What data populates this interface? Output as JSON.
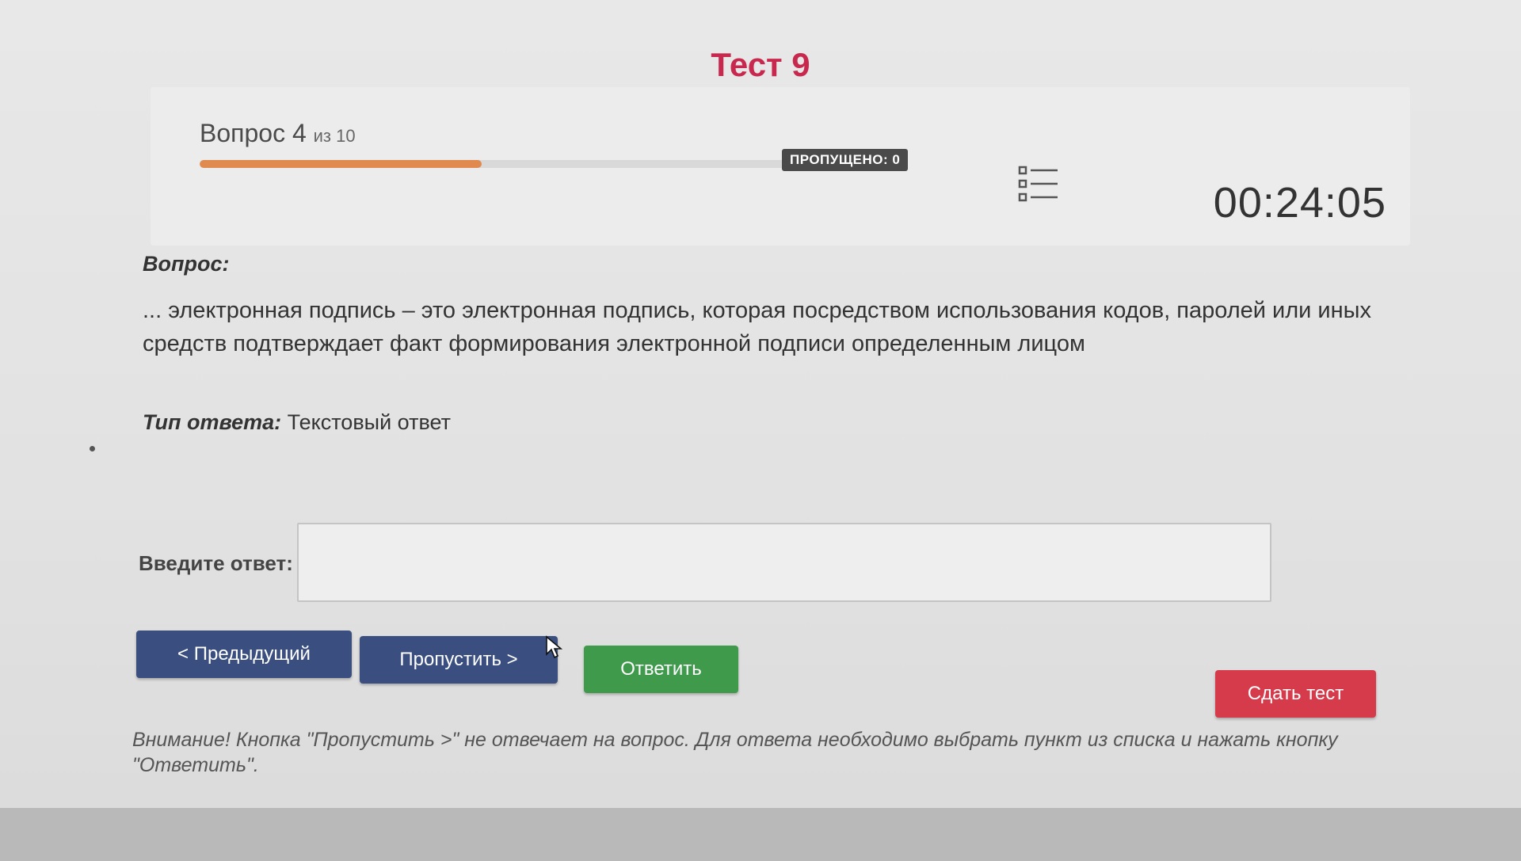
{
  "test": {
    "title": "Тест 9"
  },
  "header": {
    "question_word": "Вопрос 4",
    "question_of": "из 10",
    "progress_fraction": 0.4,
    "skipped_label": "ПРОПУЩЕНО: 0",
    "list_icon": "question-list-icon",
    "timer": "00:24:05"
  },
  "question": {
    "label": "Вопрос:",
    "text": "... электронная подпись – это электронная подпись, которая посредством использования кодов, паролей или иных средств подтверждает факт формирования электронной подписи определенным лицом"
  },
  "answer_type": {
    "label": "Тип ответа:",
    "value": "Текстовый ответ"
  },
  "answer": {
    "label": "Введите ответ:",
    "value": "",
    "placeholder": ""
  },
  "buttons": {
    "prev": "< Предыдущий",
    "skip": "Пропустить >",
    "answer": "Ответить",
    "submit": "Сдать тест"
  },
  "note": "Внимание! Кнопка \"Пропустить >\" не отвечает на вопрос. Для ответа необходимо выбрать пункт из списка и нажать кнопку \"Ответить\".",
  "colors": {
    "title": "#c8284e",
    "progress": "#e08a4f",
    "nav_button": "#3a4f7f",
    "answer_button": "#3f9a4c",
    "submit_button": "#d63b4b"
  }
}
